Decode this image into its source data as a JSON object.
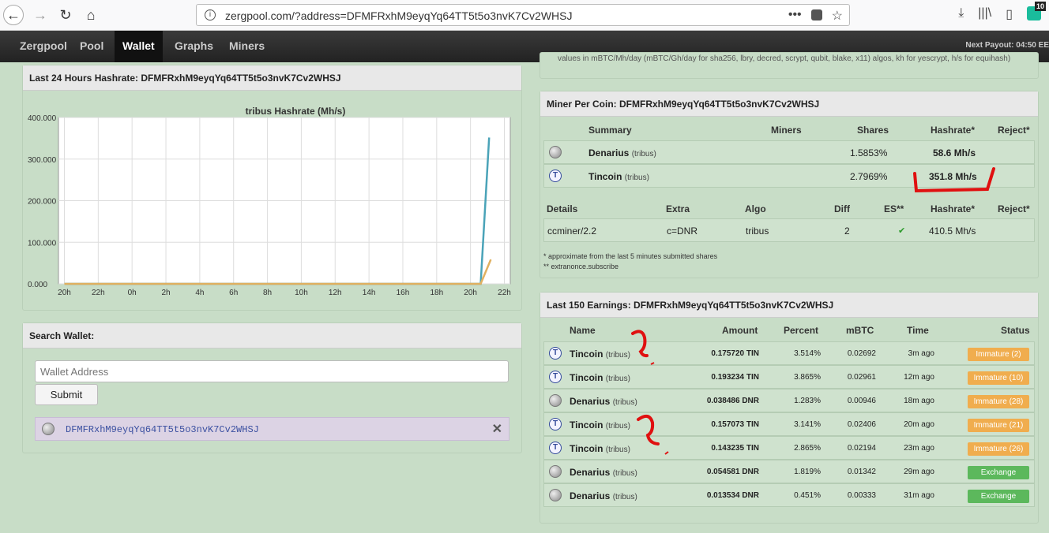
{
  "browser": {
    "url": "zergpool.com/?address=DFMFRxhM9eyqYq64TT5t5o3nvK7Cv2WHSJ",
    "url_actions": [
      "•••",
      "☆"
    ],
    "badge_count": "10"
  },
  "nav": {
    "items": [
      "Zergpool",
      "Pool",
      "Wallet",
      "Graphs",
      "Miners"
    ],
    "active": "Wallet",
    "payout": "Next Payout: 04:50 EE"
  },
  "hashrate_panel": {
    "title": "Last 24 Hours Hashrate: DFMFRxhM9eyqYq64TT5t5o3nvK7Cv2WHSJ"
  },
  "chart_data": {
    "type": "line",
    "title": "tribus Hashrate (Mh/s)",
    "x_ticks": [
      "20h",
      "22h",
      "0h",
      "2h",
      "4h",
      "6h",
      "8h",
      "10h",
      "12h",
      "14h",
      "16h",
      "18h",
      "20h",
      "22h"
    ],
    "y_ticks": [
      "400.000",
      "300.000",
      "200.000",
      "100.000",
      "0.000"
    ],
    "ylim": [
      0,
      400
    ],
    "series": [
      {
        "color": "#4aa3b8",
        "x": [
          0,
          24,
          24.6,
          25.1
        ],
        "values": [
          0,
          0,
          0,
          351.8
        ]
      },
      {
        "color": "#e0b060",
        "x": [
          0,
          24,
          24.6,
          25.2
        ],
        "values": [
          0,
          0,
          0,
          58.6
        ]
      }
    ],
    "x_range": [
      -0.35,
      26.35
    ],
    "grid": true
  },
  "search": {
    "title": "Search Wallet:",
    "placeholder": "Wallet Address",
    "submit": "Submit",
    "saved_address": "DFMFRxhM9eyqYq64TT5t5o3nvK7Cv2WHSJ",
    "remove": "✕"
  },
  "top_panel_text": "values in mBTC/Mh/day (mBTC/Gh/day for sha256, lbry, decred, scrypt, qubit, blake, x11) algos, kh for yescrypt, h/s for equihash)",
  "miner_per_coin": {
    "title": "Miner Per Coin: DFMFRxhM9eyqYq64TT5t5o3nvK7Cv2WHSJ",
    "headers": [
      "Summary",
      "Miners",
      "Shares",
      "Hashrate*",
      "Reject*"
    ],
    "rows": [
      {
        "coin": "Denarius",
        "algo": "(tribus)",
        "icon": "gray",
        "miners": "",
        "shares": "1.5853%",
        "hashrate": "58.6 Mh/s",
        "reject": ""
      },
      {
        "coin": "Tincoin",
        "algo": "(tribus)",
        "icon": "t",
        "miners": "",
        "shares": "2.7969%",
        "hashrate": "351.8 Mh/s",
        "reject": ""
      }
    ],
    "detail_headers": [
      "Details",
      "Extra",
      "Algo",
      "Diff",
      "ES**",
      "Hashrate*",
      "Reject*"
    ],
    "details": [
      {
        "details": "ccminer/2.2",
        "extra": "c=DNR",
        "algo": "tribus",
        "diff": "2",
        "es": "✔",
        "hashrate": "410.5 Mh/s",
        "reject": ""
      }
    ],
    "notes": [
      "* approximate from the last 5 minutes submitted shares",
      "** extranonce.subscribe"
    ]
  },
  "earnings": {
    "title": "Last 150 Earnings: DFMFRxhM9eyqYq64TT5t5o3nvK7Cv2WHSJ",
    "headers": [
      "Name",
      "Amount",
      "Percent",
      "mBTC",
      "Time",
      "Status"
    ],
    "rows": [
      {
        "coin": "Tincoin",
        "algo": "(tribus)",
        "icon": "t",
        "amount": "0.175720 TIN",
        "percent": "3.514%",
        "mbtc": "0.02692",
        "time": "3m ago",
        "status": "Immature (2)",
        "kind": "immature"
      },
      {
        "coin": "Tincoin",
        "algo": "(tribus)",
        "icon": "t",
        "amount": "0.193234 TIN",
        "percent": "3.865%",
        "mbtc": "0.02961",
        "time": "12m ago",
        "status": "Immature (10)",
        "kind": "immature"
      },
      {
        "coin": "Denarius",
        "algo": "(tribus)",
        "icon": "gray",
        "amount": "0.038486 DNR",
        "percent": "1.283%",
        "mbtc": "0.00946",
        "time": "18m ago",
        "status": "Immature (28)",
        "kind": "immature"
      },
      {
        "coin": "Tincoin",
        "algo": "(tribus)",
        "icon": "t",
        "amount": "0.157073 TIN",
        "percent": "3.141%",
        "mbtc": "0.02406",
        "time": "20m ago",
        "status": "Immature (21)",
        "kind": "immature"
      },
      {
        "coin": "Tincoin",
        "algo": "(tribus)",
        "icon": "t",
        "amount": "0.143235 TIN",
        "percent": "2.865%",
        "mbtc": "0.02194",
        "time": "23m ago",
        "status": "Immature (26)",
        "kind": "immature"
      },
      {
        "coin": "Denarius",
        "algo": "(tribus)",
        "icon": "gray",
        "amount": "0.054581 DNR",
        "percent": "1.819%",
        "mbtc": "0.01342",
        "time": "29m ago",
        "status": "Exchange",
        "kind": "exchange"
      },
      {
        "coin": "Denarius",
        "algo": "(tribus)",
        "icon": "gray",
        "amount": "0.013534 DNR",
        "percent": "0.451%",
        "mbtc": "0.00333",
        "time": "31m ago",
        "status": "Exchange",
        "kind": "exchange"
      }
    ]
  },
  "colors": {
    "background": "#c8ddc7",
    "nav": "#2a2a2a",
    "immature": "#f0ad4e",
    "exchange": "#5cb85c",
    "annotation_red": "#e01010"
  }
}
